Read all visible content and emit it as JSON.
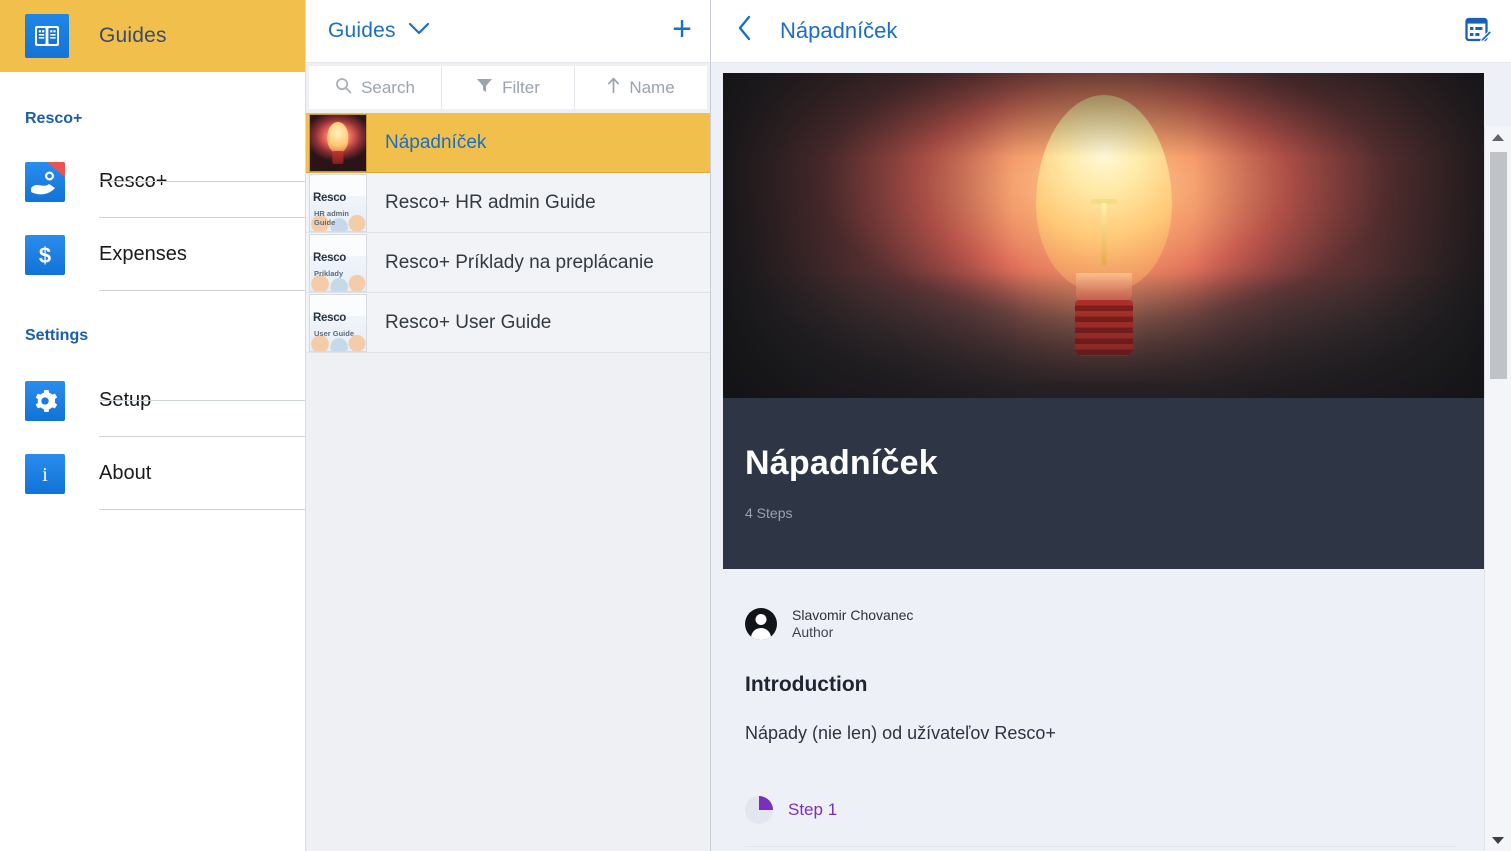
{
  "sidebar": {
    "header": {
      "title": "Guides",
      "icon": "book-icon"
    },
    "groups": [
      {
        "label": "Resco+",
        "items": [
          {
            "label": "Resco+",
            "icon": "resco-plus-icon"
          },
          {
            "label": "Expenses",
            "icon": "dollar-icon"
          }
        ]
      },
      {
        "label": "Settings",
        "items": [
          {
            "label": "Setup",
            "icon": "gear-icon"
          },
          {
            "label": "About",
            "icon": "info-icon"
          }
        ]
      }
    ]
  },
  "list_panel": {
    "title": "Guides",
    "dropdown_icon": "chevron-down-icon",
    "add_label": "+",
    "toolbar": [
      {
        "label": "Search",
        "icon": "search-icon"
      },
      {
        "label": "Filter",
        "icon": "filter-icon"
      },
      {
        "label": "Name",
        "icon": "sort-ascending-icon"
      }
    ],
    "rows": [
      {
        "label": "Nápadníček",
        "thumb": "lightbulb-thumbnail",
        "selected": true
      },
      {
        "label": "Resco+ HR admin Guide",
        "thumb": "resco-thumbnail",
        "thumb_word": "Resco",
        "thumb_sub": "HR admin Guide",
        "selected": false
      },
      {
        "label": "Resco+ Príklady na preplácanie",
        "thumb": "resco-thumbnail",
        "thumb_word": "Resco",
        "thumb_sub": "Príklady",
        "selected": false
      },
      {
        "label": "Resco+ User Guide",
        "thumb": "resco-thumbnail",
        "thumb_word": "Resco",
        "thumb_sub": "User Guide",
        "selected": false
      }
    ]
  },
  "detail": {
    "back_icon": "chevron-left-icon",
    "title": "Nápadníček",
    "form_edit_icon": "edit-form-icon",
    "hero": {
      "image": "glowing-lightbulb-photo",
      "title": "Nápadníček",
      "steps": "4 Steps"
    },
    "author": {
      "avatar": "user-avatar-icon",
      "name": "Slavomir Chovanec",
      "role": "Author"
    },
    "introduction_heading": "Introduction",
    "introduction_text": "Nápady (nie len) od užívateľov Resco+",
    "step": {
      "label": "Step 1",
      "progress_icon": "quarter-pie-icon"
    }
  },
  "scrollbar": {
    "up_icon": "scroll-up-arrow",
    "down_icon": "scroll-down-arrow"
  },
  "colors": {
    "amber": "#f0bf4c",
    "link_blue": "#1a6ec4",
    "banner_dark": "#2e3545",
    "purple": "#7b2fbe",
    "panel_bg": "#eef0f7"
  }
}
